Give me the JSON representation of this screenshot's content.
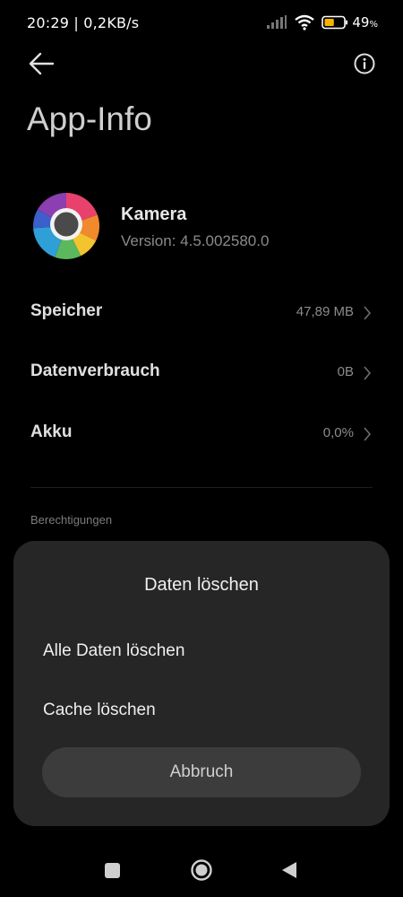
{
  "status_bar": {
    "time_speed": "20:29 | 0,2KB/s",
    "battery_percent": "49",
    "battery_symbol": "%",
    "battery_level": 0.49,
    "icons": [
      "signal-icon",
      "wifi-icon",
      "battery-icon"
    ]
  },
  "header": {
    "back_icon": "arrow-left-icon",
    "info_icon": "info-icon",
    "title": "App-Info"
  },
  "app": {
    "name": "Kamera",
    "version": "Version: 4.5.002580.0",
    "icon": "camera-app-icon"
  },
  "rows": [
    {
      "label": "Speicher",
      "value": "47,89 MB"
    },
    {
      "label": "Datenverbrauch",
      "value": "0B"
    },
    {
      "label": "Akku",
      "value": "0,0%"
    }
  ],
  "section": {
    "permissions_label": "Berechtigungen"
  },
  "dialog": {
    "title": "Daten löschen",
    "options": [
      "Alle Daten löschen",
      "Cache löschen"
    ],
    "cancel_label": "Abbruch"
  },
  "nav_bar": {
    "icons": [
      "recent-apps-icon",
      "home-icon",
      "back-triangle-icon"
    ]
  },
  "colors": {
    "background": "#000000",
    "dialog_background": "#262626",
    "button_background": "#3c3c3c",
    "battery_fill": "#f5b400"
  }
}
